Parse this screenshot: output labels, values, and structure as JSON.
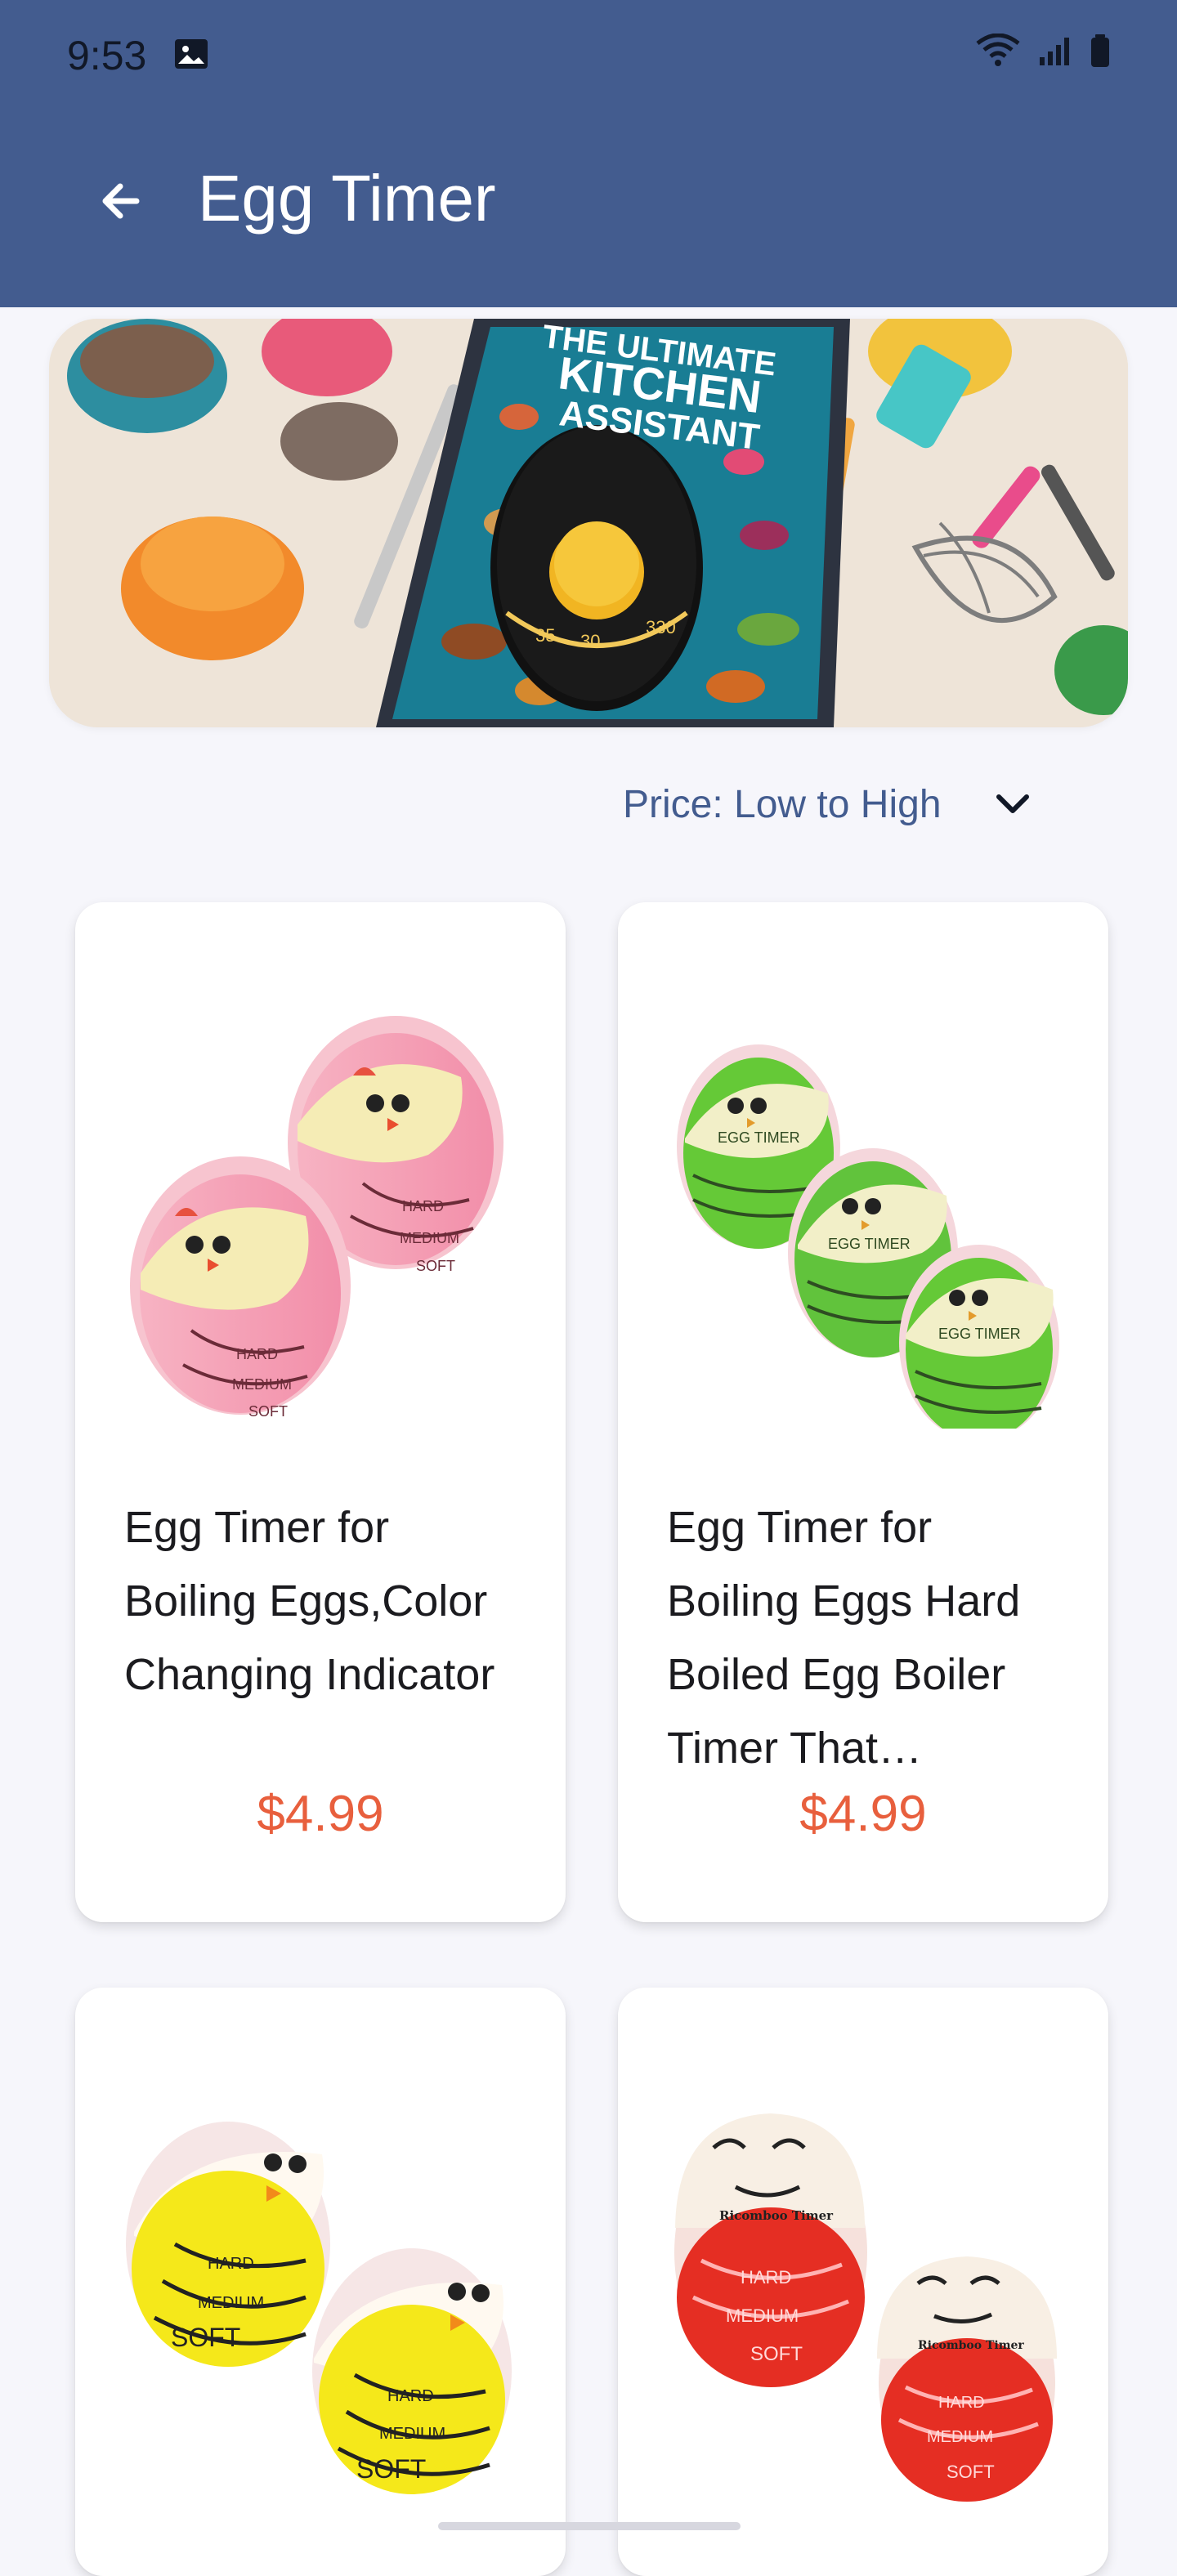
{
  "status": {
    "time": "9:53",
    "icons": [
      "gallery-icon",
      "wifi-6e-icon",
      "signal-icon",
      "battery-icon"
    ]
  },
  "appbar": {
    "title": "Egg Timer",
    "back_icon": "arrow-left-icon"
  },
  "hero": {
    "book_title_line1": "THE ULTIMATE",
    "book_title_line2": "KITCHEN",
    "book_title_line3": "ASSISTANT"
  },
  "sort": {
    "label": "Price: Low to High",
    "icon": "chevron-down-icon"
  },
  "products": [
    {
      "title": "Egg Timer for Boiling Eggs,Color Changing Indicator",
      "price": "$4.99",
      "colors": {
        "primary": "#f59fb3",
        "top": "#f4ebb6"
      }
    },
    {
      "title": "Egg Timer for Boiling Eggs Hard Boiled Egg Boiler Timer That Changes Color",
      "price": "$4.99",
      "colors": {
        "primary": "#55c22f",
        "top": "#f3efc6"
      }
    },
    {
      "title": "",
      "price": "",
      "colors": {
        "primary": "#f6ea10",
        "top": "#fff8ea"
      }
    },
    {
      "title": "",
      "price": "",
      "colors": {
        "primary": "#e42b24",
        "top": "#f7ede0"
      }
    }
  ]
}
